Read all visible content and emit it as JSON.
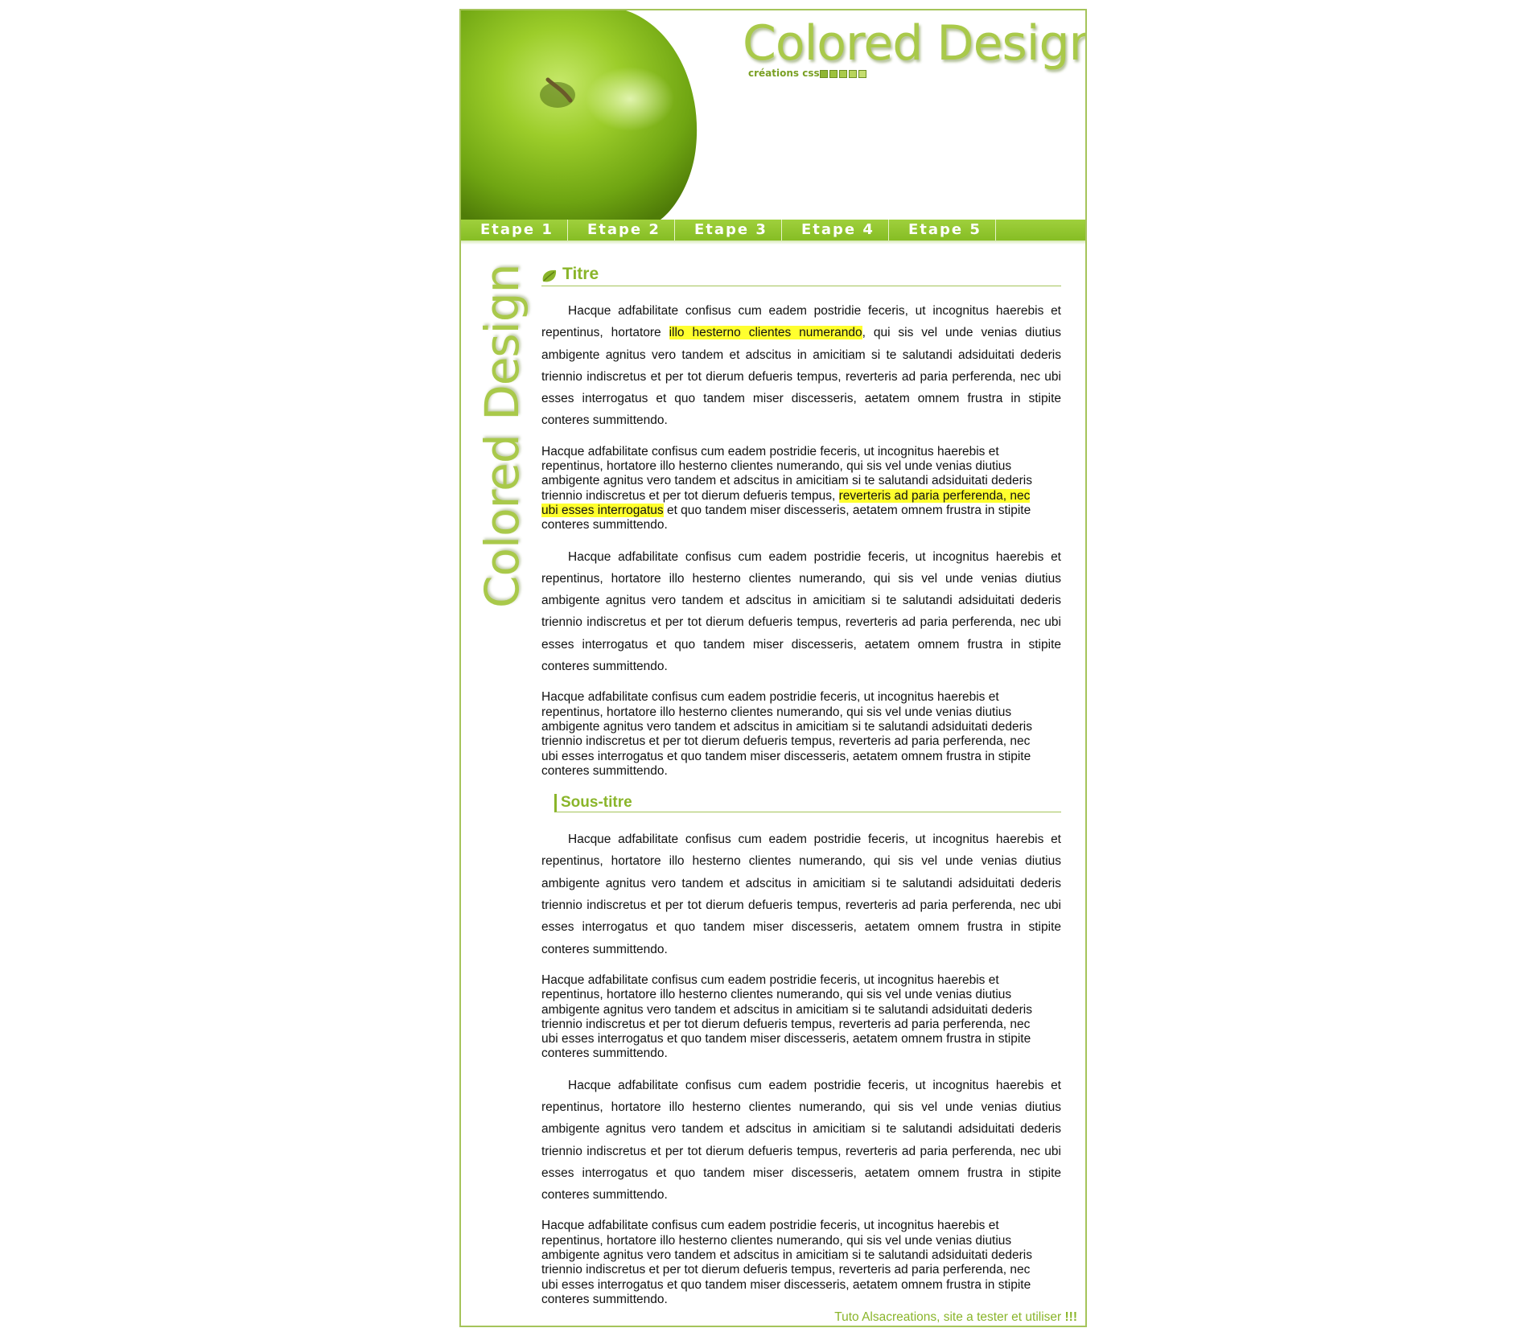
{
  "header": {
    "logo_title": "Colored Design",
    "logo_subtitle": "créations css"
  },
  "nav": {
    "items": [
      "Etape 1",
      "Etape 2",
      "Etape 3",
      "Etape 4",
      "Etape 5"
    ]
  },
  "sidebar": {
    "logo_text": "Colored Design"
  },
  "main": {
    "title": "Titre",
    "subtitle": "Sous-titre",
    "p1": {
      "before": "Hacque adfabilitate confisus cum eadem postridie feceris, ut incognitus haerebis et repentinus, hortatore ",
      "mark": "illo hesterno clientes numerando",
      "after": ", qui sis vel unde venias diutius ambigente agnitus vero tandem et adscitus in amicitiam si te salutandi adsiduitati dederis triennio indiscretus et per tot dierum defueris tempus, reverteris ad paria perferenda, nec ubi esses interrogatus et quo tandem miser discesseris, aetatem omnem frustra in stipite conteres summittendo."
    },
    "p2": {
      "line1": "Hacque adfabilitate confisus cum eadem postridie feceris, ut incognitus haerebis et",
      "line2": "repentinus, hortatore illo hesterno clientes numerando, qui sis vel unde venias diutius",
      "line3": "ambigente agnitus vero tandem et adscitus in amicitiam si te salutandi adsiduitati dederis",
      "line4_before": "triennio indiscretus et per tot dierum defueris tempus, ",
      "mark_a": "reverteris ad paria perferenda, nec",
      "mark_b": "ubi esses interrogatus",
      "line5_after": " et quo tandem miser discesseris, aetatem omnem frustra in stipite",
      "line6": "conteres summittendo."
    },
    "lorem_spaced": "Hacque adfabilitate confisus cum eadem postridie feceris, ut incognitus haerebis et repentinus, hortatore illo hesterno clientes numerando, qui sis vel unde venias diutius ambigente agnitus vero tandem et adscitus in amicitiam si te salutandi adsiduitati dederis triennio indiscretus et per tot dierum defueris tempus, reverteris ad paria perferenda, nec ubi esses interrogatus et quo tandem miser discesseris, aetatem omnem frustra in stipite conteres summittendo.",
    "lorem_tight_lines": [
      "Hacque adfabilitate confisus cum eadem postridie feceris, ut incognitus haerebis et",
      "repentinus, hortatore illo hesterno clientes numerando, qui sis vel unde venias diutius",
      "ambigente agnitus vero tandem et adscitus in amicitiam si te salutandi adsiduitati dederis",
      "triennio indiscretus et per tot dierum defueris tempus, reverteris ad paria perferenda, nec",
      "ubi esses interrogatus et quo tandem miser discesseris, aetatem omnem frustra in stipite",
      "conteres summittendo."
    ]
  },
  "footer": {
    "text": "Tuto Alsacreations, site a tester et utiliser ",
    "emphasis": "!!!"
  },
  "colors": {
    "accent": "#8ab52a",
    "nav": "#94c730",
    "highlight": "#ffff2e",
    "border": "#a5c45a"
  }
}
